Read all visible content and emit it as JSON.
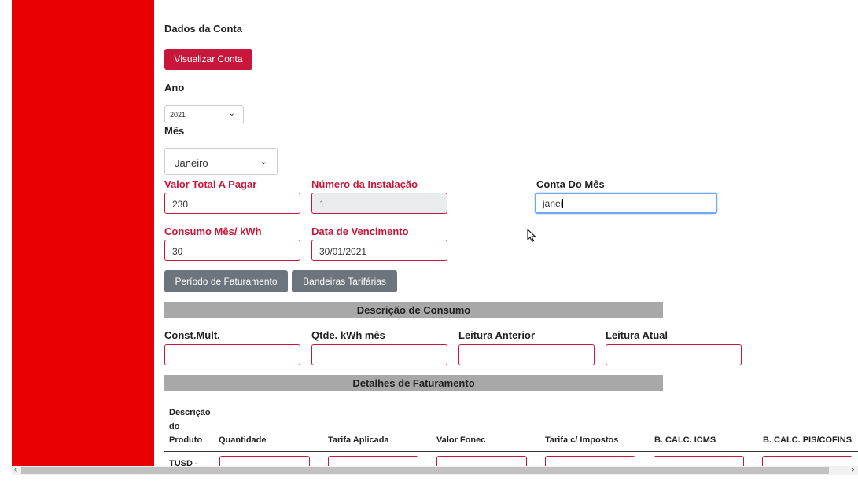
{
  "section": {
    "title": "Dados da Conta"
  },
  "view_button": "Visualizar Conta",
  "ano": {
    "label": "Ano",
    "selected": "2021"
  },
  "mes": {
    "label": "Mês",
    "selected": "Janeiro"
  },
  "fields": {
    "valor_total": {
      "label": "Valor Total A Pagar",
      "value": "230"
    },
    "numero_instalacao": {
      "label": "Número da Instalação",
      "value": "1"
    },
    "conta_do_mes": {
      "label": "Conta Do Mês",
      "value": "janei"
    },
    "consumo": {
      "label": "Consumo Mês/ kWh",
      "value": "30"
    },
    "vencimento": {
      "label": "Data de Vencimento",
      "value": "30/01/2021"
    }
  },
  "buttons": {
    "periodo": "Período de Faturamento",
    "bandeiras": "Bandeiras Tarifárias"
  },
  "descricao_consumo": {
    "title": "Descrição de Consumo",
    "labels": [
      "Const.Mult.",
      "Qtde. kWh mês",
      "Leitura Anterior",
      "Leitura Atual"
    ]
  },
  "detalhes": {
    "title": "Detalhes de Faturamento",
    "headers": [
      "Descrição",
      "do",
      "Produto",
      "Quantidade",
      "Tarifa Aplicada",
      "Valor Fonec",
      "Tarifa c/ Impostos",
      "B. CALC. ICMS",
      "B. CALC. PIS/COFINS"
    ],
    "first_row_label": "TUSD -"
  },
  "colors": {
    "sidebar": "#e80000",
    "primary": "#c8173a",
    "secondary": "#6c757d",
    "band": "#a8a8a8",
    "focus": "#6ea8fe"
  },
  "icons": {
    "select": "chevron-down-icon",
    "cursor": "mouse-pointer-icon",
    "scroll_left": "chevron-left-icon",
    "scroll_right": "chevron-right-icon"
  }
}
